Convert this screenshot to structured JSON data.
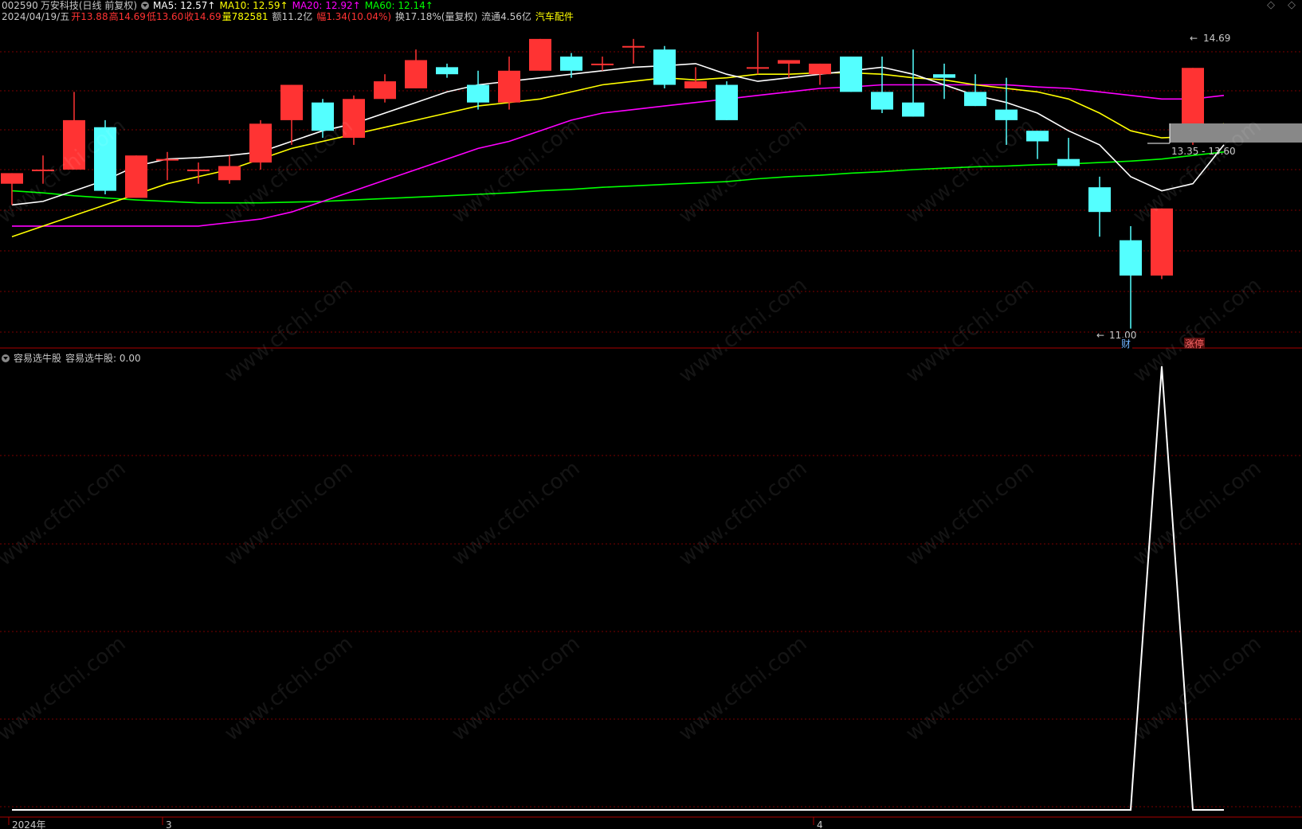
{
  "header": {
    "code": "002590",
    "name": "万安科技",
    "period": "(日线 前复权)",
    "ma5": "MA5: 12.57↑",
    "ma10": "MA10: 12.59↑",
    "ma20": "MA20: 12.92↑",
    "ma60": "MA60: 12.14↑",
    "date": "2024/04/19/五",
    "open": "开13.88",
    "high": "高14.69",
    "low": "低13.60",
    "close": "收14.69",
    "volume": "量782581",
    "amount": "额11.2亿",
    "change": "幅1.34(10.04%)",
    "turnover": "换17.18%(量复权)",
    "float": "流通4.56亿",
    "sector": "汽车配件"
  },
  "sub_header": {
    "indicator": "容易选牛股",
    "value_label": "容易选牛股: 0.00"
  },
  "annotations": {
    "high_label": "14.69",
    "low_label": "11.00",
    "range_label": "13.35 - 13.60",
    "cai": "财",
    "zhangting": "涨停"
  },
  "axis": {
    "x_labels": [
      "2024年",
      "3",
      "4"
    ]
  },
  "watermark": "www.cfchi.com",
  "colors": {
    "up": "#ff3333",
    "down": "#54ffff",
    "ma5": "#ffffff",
    "ma10": "#ffff00",
    "ma20": "#ff00ff",
    "ma60": "#00ff00",
    "grid": "#7a0000"
  },
  "chart_data": [
    {
      "type": "candlestick",
      "title": "002590 万安科技 (日线 前复权)",
      "ylim": [
        10.95,
        15.2
      ],
      "candles": [
        {
          "o": 13.05,
          "h": 13.2,
          "l": 12.75,
          "c": 13.2
        },
        {
          "o": 13.25,
          "h": 13.45,
          "l": 13.05,
          "c": 13.25
        },
        {
          "o": 13.25,
          "h": 14.35,
          "l": 13.25,
          "c": 13.95
        },
        {
          "o": 13.85,
          "h": 13.95,
          "l": 12.9,
          "c": 12.95
        },
        {
          "o": 12.85,
          "h": 13.4,
          "l": 12.85,
          "c": 13.45
        },
        {
          "o": 13.4,
          "h": 13.5,
          "l": 13.1,
          "c": 13.4
        },
        {
          "o": 13.25,
          "h": 13.35,
          "l": 13.05,
          "c": 13.25
        },
        {
          "o": 13.1,
          "h": 13.45,
          "l": 13.05,
          "c": 13.3
        },
        {
          "o": 13.35,
          "h": 13.95,
          "l": 13.25,
          "c": 13.9
        },
        {
          "o": 13.95,
          "h": 14.2,
          "l": 13.6,
          "c": 14.45
        },
        {
          "o": 14.2,
          "h": 14.25,
          "l": 13.7,
          "c": 13.8
        },
        {
          "o": 13.7,
          "h": 14.3,
          "l": 13.6,
          "c": 14.25
        },
        {
          "o": 14.25,
          "h": 14.6,
          "l": 14.2,
          "c": 14.5
        },
        {
          "o": 14.4,
          "h": 14.95,
          "l": 14.4,
          "c": 14.8
        },
        {
          "o": 14.7,
          "h": 14.75,
          "l": 14.55,
          "c": 14.6
        },
        {
          "o": 14.45,
          "h": 14.65,
          "l": 14.1,
          "c": 14.2
        },
        {
          "o": 14.2,
          "h": 14.85,
          "l": 14.1,
          "c": 14.65
        },
        {
          "o": 14.65,
          "h": 14.95,
          "l": 14.65,
          "c": 15.1
        },
        {
          "o": 14.85,
          "h": 14.9,
          "l": 14.55,
          "c": 14.65
        },
        {
          "o": 14.75,
          "h": 14.85,
          "l": 14.65,
          "c": 14.75
        },
        {
          "o": 15.0,
          "h": 15.1,
          "l": 14.75,
          "c": 15.0
        },
        {
          "o": 14.95,
          "h": 15.0,
          "l": 14.4,
          "c": 14.45
        },
        {
          "o": 14.4,
          "h": 14.7,
          "l": 14.4,
          "c": 14.5
        },
        {
          "o": 14.45,
          "h": 14.5,
          "l": 13.95,
          "c": 13.95
        },
        {
          "o": 14.7,
          "h": 15.2,
          "l": 14.6,
          "c": 14.7
        },
        {
          "o": 14.75,
          "h": 14.7,
          "l": 14.55,
          "c": 14.8
        },
        {
          "o": 14.6,
          "h": 14.7,
          "l": 14.45,
          "c": 14.75
        },
        {
          "o": 14.85,
          "h": 14.85,
          "l": 14.35,
          "c": 14.35
        },
        {
          "o": 14.35,
          "h": 14.85,
          "l": 14.05,
          "c": 14.1
        },
        {
          "o": 14.2,
          "h": 14.95,
          "l": 14.0,
          "c": 14.0
        },
        {
          "o": 14.6,
          "h": 14.75,
          "l": 14.25,
          "c": 14.55
        },
        {
          "o": 14.35,
          "h": 14.6,
          "l": 14.2,
          "c": 14.15
        },
        {
          "o": 14.1,
          "h": 14.55,
          "l": 13.6,
          "c": 13.95
        },
        {
          "o": 13.8,
          "h": 13.6,
          "l": 13.4,
          "c": 13.65
        },
        {
          "o": 13.4,
          "h": 13.7,
          "l": 13.3,
          "c": 13.3
        },
        {
          "o": 13.0,
          "h": 13.15,
          "l": 12.3,
          "c": 12.65
        },
        {
          "o": 12.25,
          "h": 12.45,
          "l": 11.0,
          "c": 11.75
        },
        {
          "o": 11.75,
          "h": 12.5,
          "l": 11.7,
          "c": 12.7
        },
        {
          "o": 13.88,
          "h": 14.69,
          "l": 13.6,
          "c": 14.69
        }
      ],
      "ma5": [
        12.75,
        12.8,
        12.95,
        13.1,
        13.3,
        13.4,
        13.42,
        13.45,
        13.5,
        13.65,
        13.8,
        13.9,
        14.05,
        14.2,
        14.35,
        14.45,
        14.5,
        14.55,
        14.6,
        14.65,
        14.7,
        14.72,
        14.75,
        14.6,
        14.5,
        14.55,
        14.6,
        14.65,
        14.7,
        14.6,
        14.45,
        14.3,
        14.2,
        14.05,
        13.8,
        13.6,
        13.15,
        12.95,
        13.05,
        13.6
      ],
      "ma10": [
        12.3,
        12.45,
        12.6,
        12.75,
        12.9,
        13.05,
        13.15,
        13.25,
        13.4,
        13.55,
        13.65,
        13.75,
        13.85,
        13.95,
        14.05,
        14.15,
        14.2,
        14.25,
        14.35,
        14.45,
        14.5,
        14.55,
        14.52,
        14.55,
        14.6,
        14.6,
        14.62,
        14.62,
        14.6,
        14.55,
        14.52,
        14.45,
        14.4,
        14.35,
        14.25,
        14.05,
        13.8,
        13.7,
        13.72,
        13.9
      ],
      "ma20": [
        12.45,
        12.45,
        12.45,
        12.45,
        12.45,
        12.45,
        12.45,
        12.5,
        12.55,
        12.65,
        12.8,
        12.95,
        13.1,
        13.25,
        13.4,
        13.55,
        13.65,
        13.8,
        13.95,
        14.05,
        14.1,
        14.15,
        14.2,
        14.25,
        14.3,
        14.35,
        14.4,
        14.42,
        14.45,
        14.45,
        14.45,
        14.45,
        14.45,
        14.42,
        14.4,
        14.35,
        14.3,
        14.25,
        14.25,
        14.3
      ],
      "ma60": [
        12.95,
        12.92,
        12.88,
        12.85,
        12.82,
        12.8,
        12.78,
        12.78,
        12.78,
        12.79,
        12.8,
        12.82,
        12.84,
        12.86,
        12.88,
        12.9,
        12.92,
        12.95,
        12.97,
        13.0,
        13.02,
        13.04,
        13.06,
        13.08,
        13.12,
        13.15,
        13.17,
        13.2,
        13.22,
        13.25,
        13.27,
        13.29,
        13.3,
        13.32,
        13.33,
        13.35,
        13.37,
        13.4,
        13.45,
        13.5
      ]
    },
    {
      "type": "line",
      "title": "容易选牛股",
      "ylim": [
        0,
        1
      ],
      "values": [
        0,
        0,
        0,
        0,
        0,
        0,
        0,
        0,
        0,
        0,
        0,
        0,
        0,
        0,
        0,
        0,
        0,
        0,
        0,
        0,
        0,
        0,
        0,
        0,
        0,
        0,
        0,
        0,
        0,
        0,
        0,
        0,
        0,
        0,
        0,
        0,
        0,
        1,
        0,
        0
      ]
    }
  ]
}
